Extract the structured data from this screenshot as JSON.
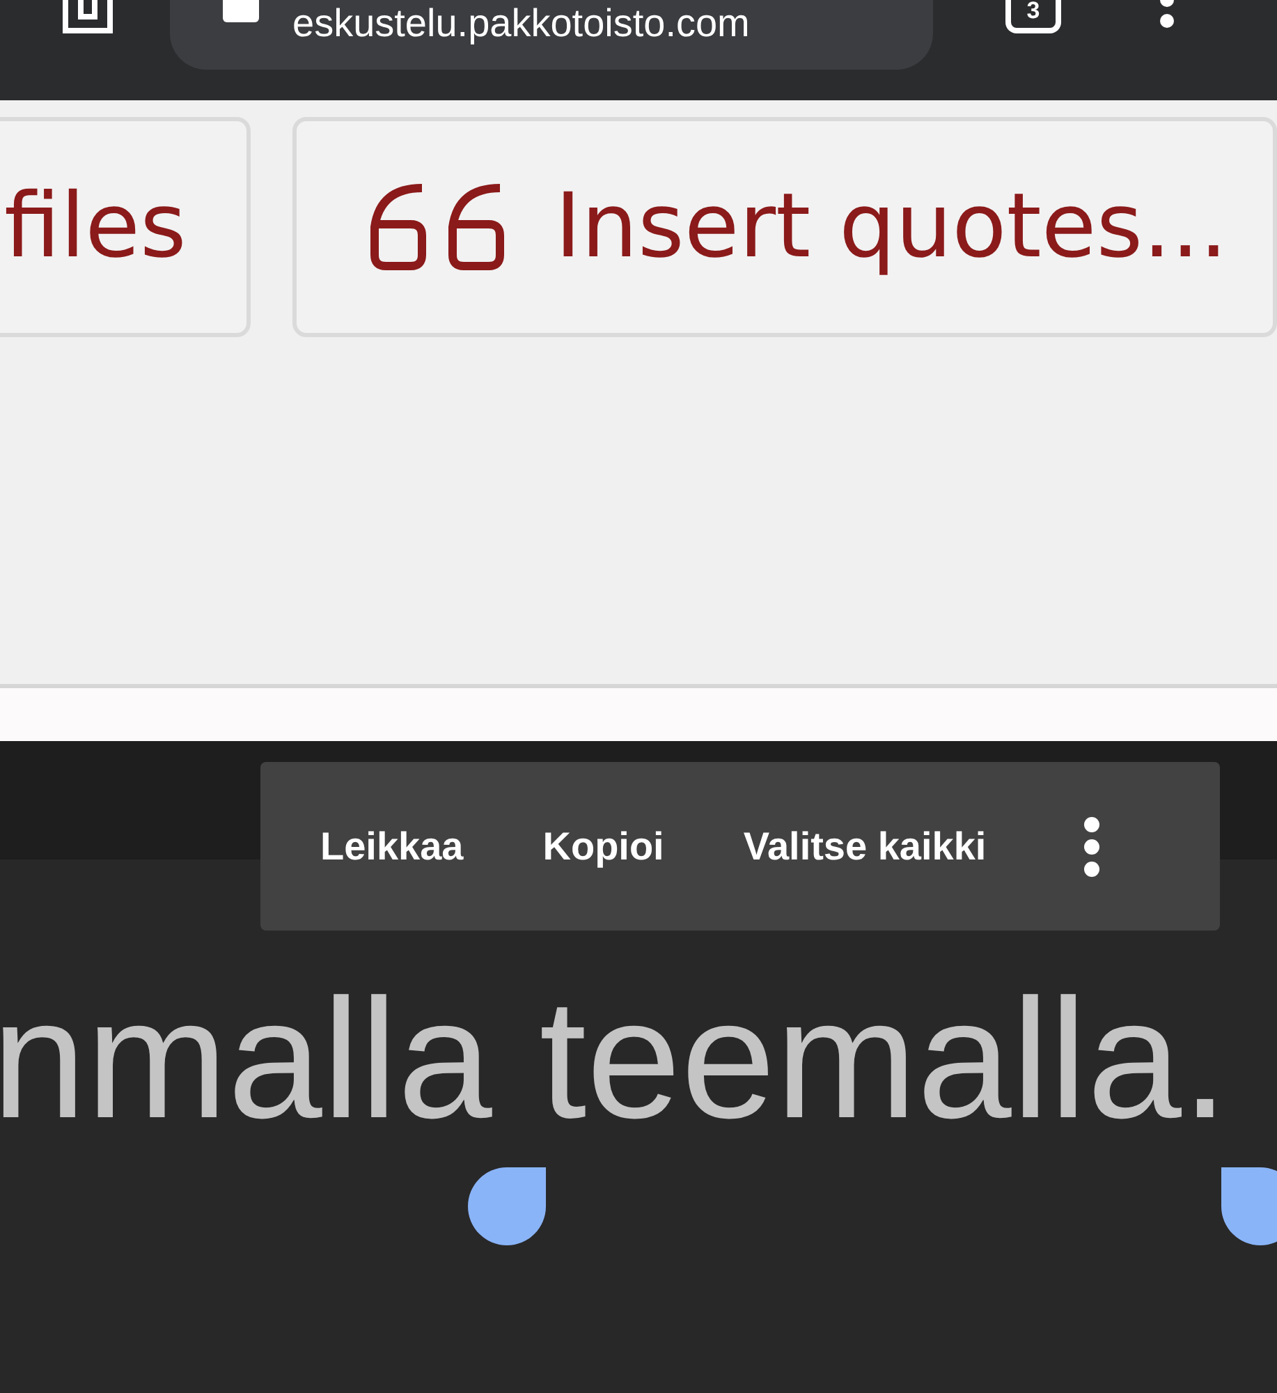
{
  "browser_bar": {
    "url": "eskustelu.pakkotoisto.com",
    "tab_count": "3"
  },
  "toolbar": {
    "buttons": [
      {
        "label": "files",
        "kind": "plain"
      },
      {
        "label": "Insert quotes...",
        "kind": "quote"
      }
    ]
  },
  "context_menu": {
    "items": [
      "Leikkaa",
      "Kopioi",
      "Valitse kaikki"
    ]
  },
  "content": {
    "text": "nmalla teemalla."
  }
}
